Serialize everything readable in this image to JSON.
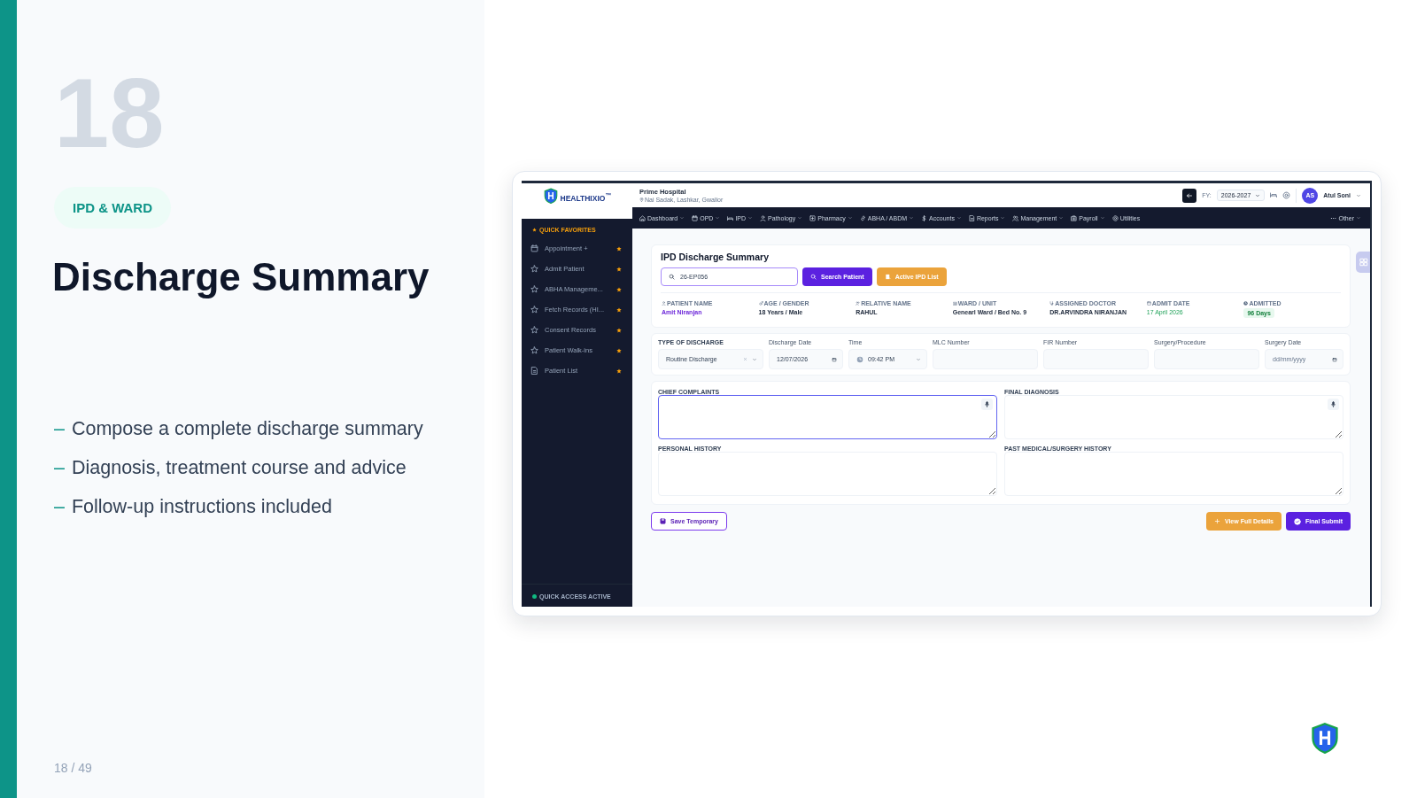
{
  "slide": {
    "number": "18",
    "tag": "IPD & WARD",
    "title": "Discharge Summary",
    "bullets": [
      {
        "marker": "–",
        "text": "Compose a complete discharge summary"
      },
      {
        "marker": "–",
        "text": "Diagnosis, treatment course and advice"
      },
      {
        "marker": "–",
        "text": "Follow-up instructions included"
      }
    ],
    "page_counter": "18 / 49"
  },
  "app": {
    "brand": "HEALTHIXIO$^{™}$",
    "header": {
      "hospital_name": "Prime Hospital",
      "hospital_address": "Nai Sadak, Lashkar, Gwalior",
      "fy_label": "FY:",
      "fy_value": "2026-2027",
      "user_initials": "AS",
      "user_name": "Atul Soni"
    },
    "nav": [
      {
        "label": "Dashboard",
        "dropdown": true
      },
      {
        "label": "OPD",
        "dropdown": true
      },
      {
        "label": "IPD",
        "dropdown": true
      },
      {
        "label": "Pathology",
        "dropdown": true
      },
      {
        "label": "Pharmacy",
        "dropdown": true
      },
      {
        "label": "ABHA / ABDM",
        "dropdown": true
      },
      {
        "label": "Accounts",
        "dropdown": true
      },
      {
        "label": "Reports",
        "dropdown": true
      },
      {
        "label": "Management",
        "dropdown": true
      },
      {
        "label": "Payroll",
        "dropdown": true
      },
      {
        "label": "Utilities",
        "dropdown": false
      }
    ],
    "nav_other": {
      "label": "Other",
      "dropdown": true
    },
    "sidebar": {
      "heading": "QUICK FAVORITES",
      "items": [
        {
          "label": "Appointment +",
          "favorite": true
        },
        {
          "label": "Admit Patient",
          "favorite": true
        },
        {
          "label": "ABHA Manageme...",
          "favorite": true
        },
        {
          "label": "Fetch Records (HI...",
          "favorite": true
        },
        {
          "label": "Consent Records",
          "favorite": true
        },
        {
          "label": "Patient Walk-ins",
          "favorite": true
        },
        {
          "label": "Patient List",
          "favorite": true
        }
      ],
      "footer": "QUICK ACCESS ACTIVE"
    },
    "form": {
      "title": "IPD Discharge Summary",
      "search_value": "26-EP056",
      "search_button": "Search Patient",
      "list_button": "Active IPD List",
      "patient": [
        {
          "label": "PATIENT NAME",
          "value": "Amit Niranjan",
          "kind": "link"
        },
        {
          "label": "AGE / GENDER",
          "value": "18 Years / Male",
          "kind": "text"
        },
        {
          "label": "RELATIVE NAME",
          "value": "RAHUL",
          "kind": "text"
        },
        {
          "label": "WARD / UNIT",
          "value": "Genearl Ward / Bed No. 9",
          "kind": "text"
        },
        {
          "label": "ASSIGNED DOCTOR",
          "value": "DR.ARVINDRA NIRANJAN",
          "kind": "text"
        },
        {
          "label": "ADMIT DATE",
          "value": "17 April 2026",
          "kind": "date"
        },
        {
          "label": "ADMITTED",
          "value": "96 Days",
          "kind": "badge"
        }
      ],
      "fields": [
        {
          "label": "TYPE OF DISCHARGE",
          "kind": "select",
          "value": "Routine Discharge"
        },
        {
          "label": "Discharge Date",
          "kind": "date",
          "value": "12/07/2026"
        },
        {
          "label": "Time",
          "kind": "time",
          "value": "09:42 PM"
        },
        {
          "label": "MLC Number",
          "kind": "text"
        },
        {
          "label": "FIR Number",
          "kind": "text"
        },
        {
          "label": "Surgery/Procedure",
          "kind": "text"
        },
        {
          "label": "Surgery Date",
          "kind": "date",
          "placeholder": "dd/mm/yyyy"
        }
      ],
      "notes": [
        {
          "label": "CHIEF COMPLAINTS",
          "mic": true,
          "focused": true
        },
        {
          "label": "FINAL DIAGNOSIS",
          "mic": true,
          "focused": false
        },
        {
          "label": "PERSONAL HISTORY",
          "mic": false,
          "focused": false
        },
        {
          "label": "PAST MEDICAL/SURGERY HISTORY",
          "mic": false,
          "focused": false
        }
      ],
      "save_button": "Save Temporary",
      "details_button": "View Full Details",
      "submit_button": "Final Submit"
    }
  }
}
